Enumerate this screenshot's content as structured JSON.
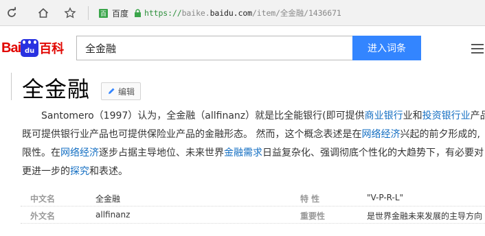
{
  "browser": {
    "site_label": "百度",
    "url_scheme": "https://",
    "url_sub": "baike.",
    "url_domain": "baidu.com",
    "url_path": "/item/全金融/1436671",
    "badge_char": "百"
  },
  "header": {
    "logo_bai": "Bai",
    "logo_du": "du",
    "logo_baike": "百科",
    "search_value": "全金融",
    "search_button": "进入词条",
    "brand_red": "#e10601",
    "brand_blue": "#2932e1",
    "button_blue": "#3385ff"
  },
  "article": {
    "title": "全金融",
    "edit_label": "编辑",
    "paragraph": {
      "l1_a": "Santomero（1997）认为，全金融（allfinanz）就是比全能银行(即可提供",
      "l1_link1": "商业银行",
      "l1_b": "业和",
      "l1_link2": "投资银行业",
      "l1_c": "产品的",
      "l2_a": "既可提供银行业产品也可提供保险业产品的金融形态。 然而，这个概念表述是在",
      "l2_link": "网络经济",
      "l2_b": "兴起的前夕形成的,",
      "l3_a": "限性。在",
      "l3_link1": "网络经济",
      "l3_b": "逐步占据主导地位、未来世界",
      "l3_link2": "金融需求",
      "l3_c": "日益复杂化、强调彻底个性化的大趋势下，有必要对",
      "l4_a": "更进一步的",
      "l4_link": "探究",
      "l4_b": "和表述。"
    },
    "link_color": "#136ec2"
  },
  "infobox": {
    "rows": [
      {
        "label1": "中文名",
        "value1": "全金融",
        "label2": "特    性",
        "value2": "\"V-P-R-L\""
      },
      {
        "label1": "外文名",
        "value1": "allfinanz",
        "label2": "重要性",
        "value2": "是世界金融未来发展的主导方向"
      }
    ]
  }
}
